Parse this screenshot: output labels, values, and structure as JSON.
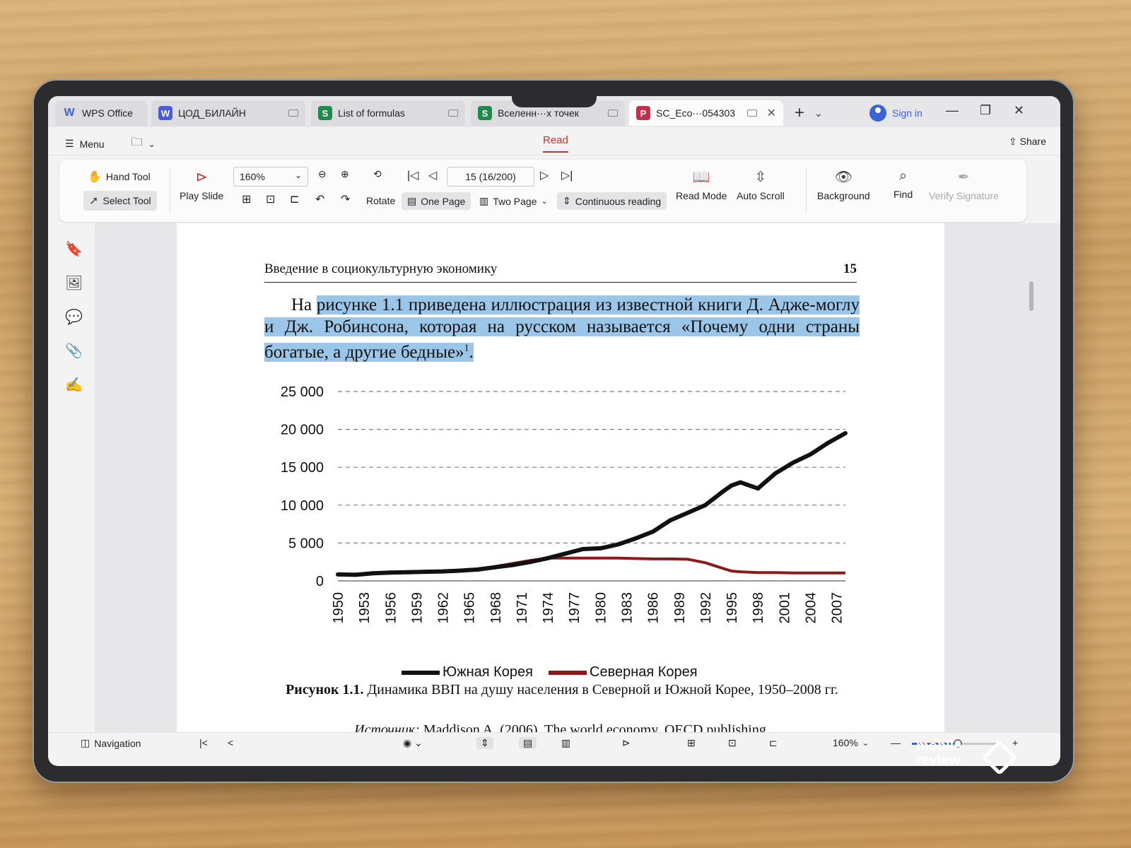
{
  "tabs": [
    {
      "label": "WPS Office",
      "icon": "wps-logo-icon",
      "color": "#3a63d6"
    },
    {
      "label": "ЦОД_БИЛАЙН",
      "icon": "W",
      "color": "#4a5bd8"
    },
    {
      "label": "List of formulas",
      "icon": "S",
      "color": "#1f8a4c"
    },
    {
      "label": "Вселенн···х точек",
      "icon": "S",
      "color": "#1f8a4c"
    },
    {
      "label": "SC_Eco···054303",
      "icon": "P",
      "color": "#c0304a"
    }
  ],
  "signin": "Sign in",
  "menu": {
    "label": "Menu",
    "read_tab": "Read",
    "share": "Share"
  },
  "toolbar": {
    "hand_tool": "Hand Tool",
    "select_tool": "Select Tool",
    "play_slide": "Play Slide",
    "zoom": "160%",
    "rotate": "Rotate",
    "page_box": "15 (16/200)",
    "one_page": "One Page",
    "two_page": "Two Page",
    "continuous": "Continuous reading",
    "read_mode": "Read Mode",
    "auto_scroll": "Auto Scroll",
    "background": "Background",
    "find": "Find",
    "verify_signature": "Verify Signature"
  },
  "document": {
    "running_head": "Введение в социокультурную экономику",
    "page_number": "15",
    "para_before_highlight": "На ",
    "para_highlight": "рисунке 1.1 приведена иллюстрация из известной книги Д. Адже-моглу и Дж. Робинсона, которая на русском называется «Почему одни страны богатые, а другие бедные»",
    "footnote_mark": "1",
    "para_end": ".",
    "caption_bold": "Рисунок 1.1.",
    "caption_text": " Динамика ВВП на душу населения в Северной и Южной Корее, 1950–2008 гг.",
    "source_label": "Источник:",
    "source_text": " Maddison A. (2006). The world economy. OECD publishing."
  },
  "chart_data": {
    "type": "line",
    "x": [
      1950,
      1952,
      1954,
      1956,
      1958,
      1960,
      1962,
      1964,
      1966,
      1968,
      1970,
      1972,
      1974,
      1976,
      1978,
      1980,
      1982,
      1984,
      1986,
      1988,
      1990,
      1992,
      1994,
      1995,
      1996,
      1998,
      2000,
      2002,
      2004,
      2006,
      2008
    ],
    "xticks": [
      "1950",
      "1953",
      "1956",
      "1959",
      "1962",
      "1965",
      "1968",
      "1971",
      "1974",
      "1977",
      "1980",
      "1983",
      "1986",
      "1989",
      "1992",
      "1995",
      "1998",
      "2001",
      "2004",
      "2007"
    ],
    "yticks": [
      "0",
      "5 000",
      "10 000",
      "15 000",
      "20 000",
      "25 000"
    ],
    "ylim": [
      0,
      25000
    ],
    "xlim": [
      1950,
      2008
    ],
    "grid": "dashed horizontal",
    "legend": "bottom",
    "series": [
      {
        "name": "Южная Корея",
        "color": "#111111",
        "values": [
          850,
          800,
          1000,
          1100,
          1150,
          1200,
          1250,
          1350,
          1500,
          1800,
          2100,
          2500,
          3000,
          3600,
          4200,
          4300,
          4800,
          5600,
          6500,
          8000,
          9000,
          10000,
          11800,
          12600,
          13000,
          12200,
          14200,
          15600,
          16700,
          18200,
          19500
        ]
      },
      {
        "name": "Северная Корея",
        "color": "#8b1a1a",
        "values": [
          850,
          750,
          1000,
          1100,
          1150,
          1200,
          1300,
          1400,
          1550,
          1900,
          2300,
          2700,
          3000,
          3000,
          3000,
          3000,
          3000,
          2950,
          2900,
          2900,
          2850,
          2400,
          1650,
          1300,
          1200,
          1100,
          1100,
          1050,
          1050,
          1050,
          1050
        ]
      }
    ]
  },
  "statusbar": {
    "navigation": "Navigation",
    "zoom": "160%",
    "zoom_fraction": 0.5
  },
  "watermark": {
    "line1": "mobile",
    "line2": "review"
  }
}
